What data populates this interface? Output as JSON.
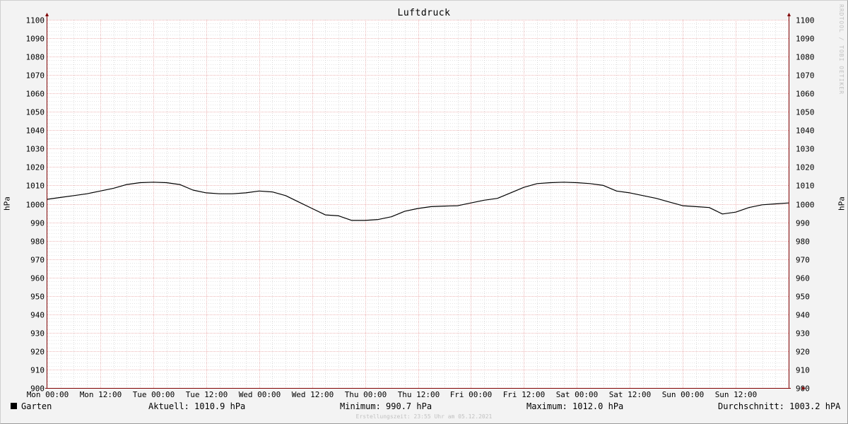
{
  "chart_data": {
    "type": "line",
    "title": "Luftdruck",
    "ylabel": "hPa",
    "ylabel_right": "hPa",
    "ylim": [
      900,
      1100
    ],
    "y_ticks": [
      900,
      910,
      920,
      930,
      940,
      950,
      960,
      970,
      980,
      990,
      1000,
      1010,
      1020,
      1030,
      1040,
      1050,
      1060,
      1070,
      1080,
      1090,
      1100
    ],
    "x_tick_labels": [
      "Mon 00:00",
      "Mon 12:00",
      "Tue 00:00",
      "Tue 12:00",
      "Wed 00:00",
      "Wed 12:00",
      "Thu 00:00",
      "Thu 12:00",
      "Fri 00:00",
      "Fri 12:00",
      "Sat 00:00",
      "Sat 12:00",
      "Sun 00:00",
      "Sun 12:00"
    ],
    "x_unit": "hours since Mon 00:00",
    "grid": true,
    "legend_position": "bottom-left",
    "colors": {
      "line": "#000000",
      "grid_major": "#e8a0a0",
      "grid_minor": "#c8c8c8",
      "axis": "#800000",
      "background": "#ffffff"
    },
    "series": [
      {
        "name": "Garten",
        "x": [
          0,
          3,
          6,
          9,
          12,
          15,
          18,
          21,
          24,
          27,
          30,
          33,
          36,
          39,
          42,
          45,
          48,
          51,
          54,
          57,
          60,
          63,
          66,
          69,
          72,
          75,
          78,
          81,
          84,
          87,
          90,
          93,
          96,
          99,
          102,
          105,
          108,
          111,
          114,
          117,
          120,
          123,
          126,
          129,
          132,
          135,
          138,
          141,
          144,
          147,
          150,
          153,
          156,
          159,
          162,
          165,
          168
        ],
        "values": [
          1002.5,
          1003.5,
          1004.5,
          1005.5,
          1007,
          1008.5,
          1010.5,
          1011.5,
          1011.8,
          1011.5,
          1010.5,
          1007.5,
          1006,
          1005.5,
          1005.5,
          1006,
          1007,
          1006.5,
          1004.5,
          1001,
          997.5,
          994,
          993.5,
          991,
          991,
          991.5,
          993,
          996,
          997.5,
          998.5,
          998.8,
          999,
          1000.5,
          1002,
          1003,
          1006,
          1009,
          1011,
          1011.5,
          1011.8,
          1011.5,
          1011,
          1010,
          1007,
          1006,
          1004.5,
          1003,
          1001,
          999,
          998.5,
          998,
          994.5,
          995.5,
          998,
          999.5,
          1000,
          1000.5
        ]
      }
    ]
  },
  "watermark": "RRDTOOL / TOBI OETIKER",
  "legend": {
    "series_name": "Garten",
    "current": "Aktuell: 1010.9 hPa",
    "minimum": "Minimum: 990.7 hPa",
    "maximum": "Maximum: 1012.0 hPa",
    "average": "Durchschnitt: 1003.2 hPA"
  },
  "footer": "Erstellungszeit: 23:55 Uhr am 05.12.2021"
}
